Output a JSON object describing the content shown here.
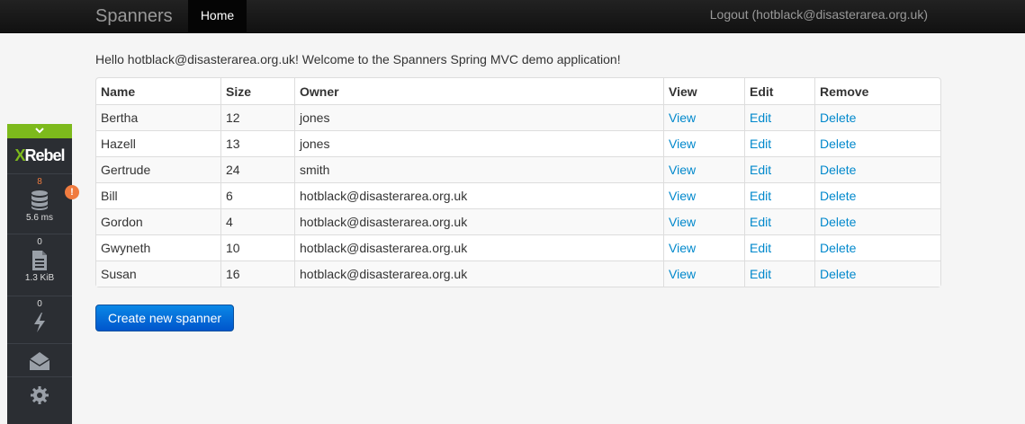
{
  "navbar": {
    "brand": "Spanners",
    "home_label": "Home",
    "logout_label": "Logout (hotblack@disasterarea.org.uk)"
  },
  "greeting": "Hello hotblack@disasterarea.org.uk! Welcome to the Spanners Spring MVC demo application!",
  "table": {
    "headers": [
      "Name",
      "Size",
      "Owner",
      "View",
      "Edit",
      "Remove"
    ],
    "rows": [
      {
        "name": "Bertha",
        "size": "12",
        "owner": "jones",
        "view": "View",
        "edit": "Edit",
        "remove": "Delete"
      },
      {
        "name": "Hazell",
        "size": "13",
        "owner": "jones",
        "view": "View",
        "edit": "Edit",
        "remove": "Delete"
      },
      {
        "name": "Gertrude",
        "size": "24",
        "owner": "smith",
        "view": "View",
        "edit": "Edit",
        "remove": "Delete"
      },
      {
        "name": "Bill",
        "size": "6",
        "owner": "hotblack@disasterarea.org.uk",
        "view": "View",
        "edit": "Edit",
        "remove": "Delete"
      },
      {
        "name": "Gordon",
        "size": "4",
        "owner": "hotblack@disasterarea.org.uk",
        "view": "View",
        "edit": "Edit",
        "remove": "Delete"
      },
      {
        "name": "Gwyneth",
        "size": "10",
        "owner": "hotblack@disasterarea.org.uk",
        "view": "View",
        "edit": "Edit",
        "remove": "Delete"
      },
      {
        "name": "Susan",
        "size": "16",
        "owner": "hotblack@disasterarea.org.uk",
        "view": "View",
        "edit": "Edit",
        "remove": "Delete"
      }
    ]
  },
  "create_button": "Create new spanner",
  "xrebel": {
    "logo_x": "X",
    "logo_rest": "Rebel",
    "collapse_icon": "chevron-down-icon",
    "db": {
      "count": "8",
      "time": "5.6 ms",
      "icon": "database-icon",
      "warning": "!"
    },
    "io": {
      "count": "0",
      "size": "1.3 KiB",
      "icon": "document-icon"
    },
    "exceptions": {
      "count": "0",
      "icon": "lightning-icon"
    },
    "mail_icon": "envelope-icon",
    "settings_icon": "gear-icon"
  },
  "colors": {
    "link": "#0088cc",
    "navbar": "#1b1b1b",
    "button": "#0066cc",
    "xrebel_accent": "#7dba1c",
    "warning": "#f07b3f"
  }
}
